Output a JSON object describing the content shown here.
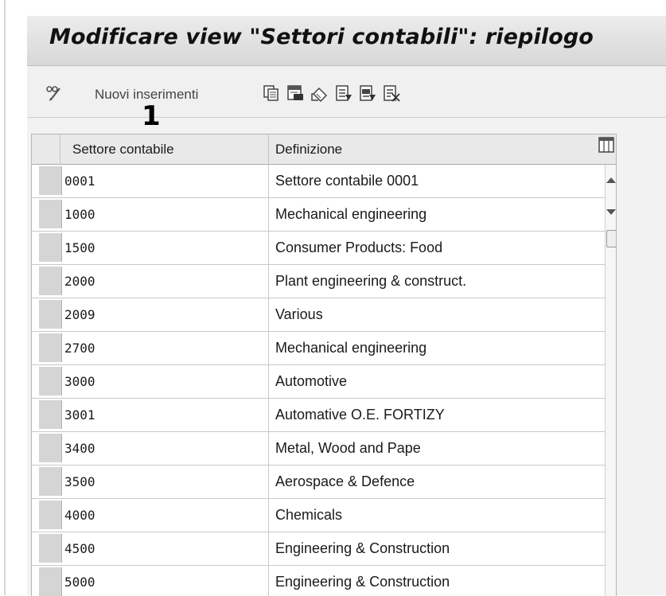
{
  "window": {
    "title": "Modificare view \"Settori contabili\": riepilogo"
  },
  "toolbar": {
    "new_entries_label": "Nuovi inserimenti",
    "icons": [
      "pencil-glasses-icon",
      "copy-icon",
      "save-icon",
      "undo-icon",
      "select-all-icon",
      "select-block-icon",
      "deselect-all-icon"
    ]
  },
  "annotation": {
    "marker": "1"
  },
  "table": {
    "columns": [
      "Settore contabile",
      "Definizione"
    ],
    "rows": [
      {
        "code": "0001",
        "definition": "Settore contabile 0001"
      },
      {
        "code": "1000",
        "definition": "Mechanical engineering"
      },
      {
        "code": "1500",
        "definition": "Consumer Products: Food"
      },
      {
        "code": "2000",
        "definition": "Plant engineering & construct."
      },
      {
        "code": "2009",
        "definition": "Various"
      },
      {
        "code": "2700",
        "definition": "Mechanical engineering"
      },
      {
        "code": "3000",
        "definition": "Automotive"
      },
      {
        "code": "3001",
        "definition": "Automative O.E. FORTIZY"
      },
      {
        "code": "3400",
        "definition": "Metal, Wood and Pape"
      },
      {
        "code": "3500",
        "definition": "Aerospace & Defence"
      },
      {
        "code": "4000",
        "definition": "Chemicals"
      },
      {
        "code": "4500",
        "definition": "Engineering & Construction"
      },
      {
        "code": "5000",
        "definition": "Engineering & Construction"
      }
    ]
  }
}
